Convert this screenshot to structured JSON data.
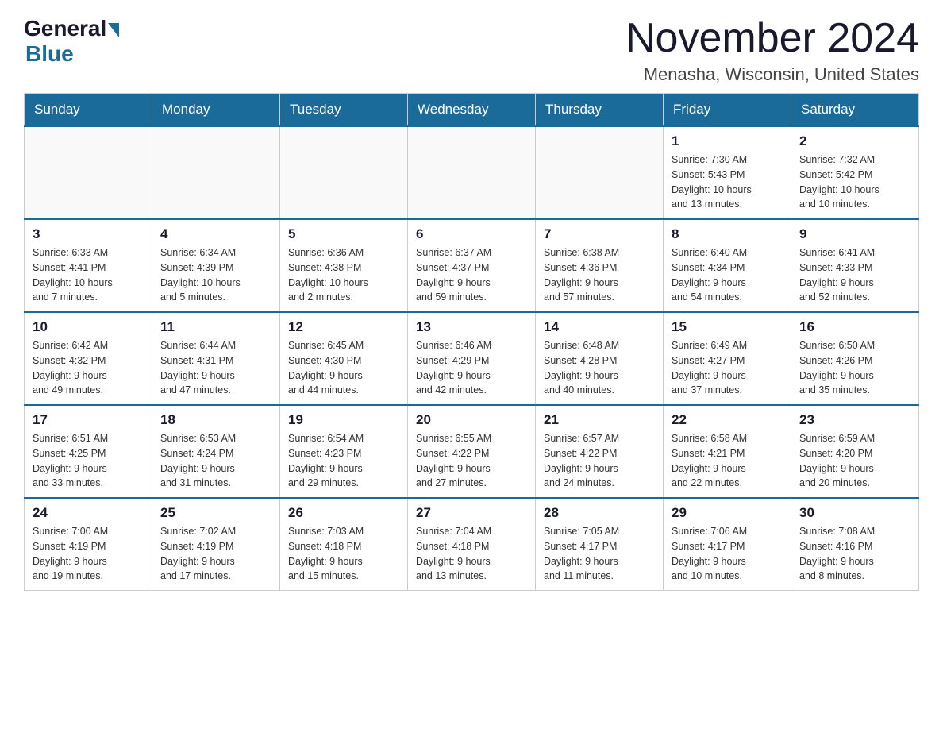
{
  "header": {
    "logo_general": "General",
    "logo_blue": "Blue",
    "month_title": "November 2024",
    "location": "Menasha, Wisconsin, United States"
  },
  "weekdays": [
    "Sunday",
    "Monday",
    "Tuesday",
    "Wednesday",
    "Thursday",
    "Friday",
    "Saturday"
  ],
  "weeks": [
    [
      {
        "day": "",
        "info": ""
      },
      {
        "day": "",
        "info": ""
      },
      {
        "day": "",
        "info": ""
      },
      {
        "day": "",
        "info": ""
      },
      {
        "day": "",
        "info": ""
      },
      {
        "day": "1",
        "info": "Sunrise: 7:30 AM\nSunset: 5:43 PM\nDaylight: 10 hours\nand 13 minutes."
      },
      {
        "day": "2",
        "info": "Sunrise: 7:32 AM\nSunset: 5:42 PM\nDaylight: 10 hours\nand 10 minutes."
      }
    ],
    [
      {
        "day": "3",
        "info": "Sunrise: 6:33 AM\nSunset: 4:41 PM\nDaylight: 10 hours\nand 7 minutes."
      },
      {
        "day": "4",
        "info": "Sunrise: 6:34 AM\nSunset: 4:39 PM\nDaylight: 10 hours\nand 5 minutes."
      },
      {
        "day": "5",
        "info": "Sunrise: 6:36 AM\nSunset: 4:38 PM\nDaylight: 10 hours\nand 2 minutes."
      },
      {
        "day": "6",
        "info": "Sunrise: 6:37 AM\nSunset: 4:37 PM\nDaylight: 9 hours\nand 59 minutes."
      },
      {
        "day": "7",
        "info": "Sunrise: 6:38 AM\nSunset: 4:36 PM\nDaylight: 9 hours\nand 57 minutes."
      },
      {
        "day": "8",
        "info": "Sunrise: 6:40 AM\nSunset: 4:34 PM\nDaylight: 9 hours\nand 54 minutes."
      },
      {
        "day": "9",
        "info": "Sunrise: 6:41 AM\nSunset: 4:33 PM\nDaylight: 9 hours\nand 52 minutes."
      }
    ],
    [
      {
        "day": "10",
        "info": "Sunrise: 6:42 AM\nSunset: 4:32 PM\nDaylight: 9 hours\nand 49 minutes."
      },
      {
        "day": "11",
        "info": "Sunrise: 6:44 AM\nSunset: 4:31 PM\nDaylight: 9 hours\nand 47 minutes."
      },
      {
        "day": "12",
        "info": "Sunrise: 6:45 AM\nSunset: 4:30 PM\nDaylight: 9 hours\nand 44 minutes."
      },
      {
        "day": "13",
        "info": "Sunrise: 6:46 AM\nSunset: 4:29 PM\nDaylight: 9 hours\nand 42 minutes."
      },
      {
        "day": "14",
        "info": "Sunrise: 6:48 AM\nSunset: 4:28 PM\nDaylight: 9 hours\nand 40 minutes."
      },
      {
        "day": "15",
        "info": "Sunrise: 6:49 AM\nSunset: 4:27 PM\nDaylight: 9 hours\nand 37 minutes."
      },
      {
        "day": "16",
        "info": "Sunrise: 6:50 AM\nSunset: 4:26 PM\nDaylight: 9 hours\nand 35 minutes."
      }
    ],
    [
      {
        "day": "17",
        "info": "Sunrise: 6:51 AM\nSunset: 4:25 PM\nDaylight: 9 hours\nand 33 minutes."
      },
      {
        "day": "18",
        "info": "Sunrise: 6:53 AM\nSunset: 4:24 PM\nDaylight: 9 hours\nand 31 minutes."
      },
      {
        "day": "19",
        "info": "Sunrise: 6:54 AM\nSunset: 4:23 PM\nDaylight: 9 hours\nand 29 minutes."
      },
      {
        "day": "20",
        "info": "Sunrise: 6:55 AM\nSunset: 4:22 PM\nDaylight: 9 hours\nand 27 minutes."
      },
      {
        "day": "21",
        "info": "Sunrise: 6:57 AM\nSunset: 4:22 PM\nDaylight: 9 hours\nand 24 minutes."
      },
      {
        "day": "22",
        "info": "Sunrise: 6:58 AM\nSunset: 4:21 PM\nDaylight: 9 hours\nand 22 minutes."
      },
      {
        "day": "23",
        "info": "Sunrise: 6:59 AM\nSunset: 4:20 PM\nDaylight: 9 hours\nand 20 minutes."
      }
    ],
    [
      {
        "day": "24",
        "info": "Sunrise: 7:00 AM\nSunset: 4:19 PM\nDaylight: 9 hours\nand 19 minutes."
      },
      {
        "day": "25",
        "info": "Sunrise: 7:02 AM\nSunset: 4:19 PM\nDaylight: 9 hours\nand 17 minutes."
      },
      {
        "day": "26",
        "info": "Sunrise: 7:03 AM\nSunset: 4:18 PM\nDaylight: 9 hours\nand 15 minutes."
      },
      {
        "day": "27",
        "info": "Sunrise: 7:04 AM\nSunset: 4:18 PM\nDaylight: 9 hours\nand 13 minutes."
      },
      {
        "day": "28",
        "info": "Sunrise: 7:05 AM\nSunset: 4:17 PM\nDaylight: 9 hours\nand 11 minutes."
      },
      {
        "day": "29",
        "info": "Sunrise: 7:06 AM\nSunset: 4:17 PM\nDaylight: 9 hours\nand 10 minutes."
      },
      {
        "day": "30",
        "info": "Sunrise: 7:08 AM\nSunset: 4:16 PM\nDaylight: 9 hours\nand 8 minutes."
      }
    ]
  ]
}
